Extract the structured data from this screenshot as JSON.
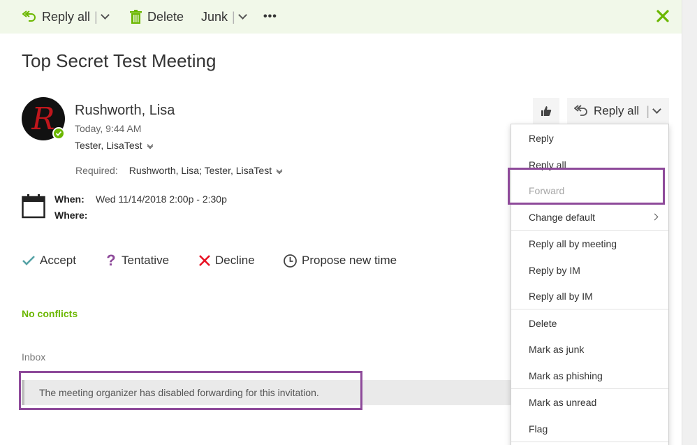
{
  "toolbar": {
    "reply_all_label": "Reply all",
    "delete_label": "Delete",
    "junk_label": "Junk",
    "more_label": "•••"
  },
  "message": {
    "subject": "Top Secret Test Meeting",
    "sender_name": "Rushworth, Lisa",
    "avatar_letter": "R",
    "sent_time": "Today, 9:44 AM",
    "to": "Tester, LisaTest",
    "required_label": "Required:",
    "required_value": "Rushworth, Lisa; Tester, LisaTest",
    "when_label": "When:",
    "when_value": "Wed 11/14/2018 2:00p - 2:30p",
    "where_label": "Where:",
    "no_conflicts": "No conflicts",
    "folder": "Inbox",
    "info_notice": "The meeting organizer has disabled forwarding for this invitation."
  },
  "rsvp": {
    "accept": "Accept",
    "tentative": "Tentative",
    "decline": "Decline",
    "propose": "Propose new time"
  },
  "header_actions": {
    "reply_all_label": "Reply all"
  },
  "menu": {
    "items": [
      {
        "label": "Reply"
      },
      {
        "label": "Reply all"
      },
      {
        "label": "Forward"
      },
      {
        "label": "Change default"
      },
      {
        "label": "Reply all by meeting"
      },
      {
        "label": "Reply by IM"
      },
      {
        "label": "Reply all by IM"
      },
      {
        "label": "Delete"
      },
      {
        "label": "Mark as junk"
      },
      {
        "label": "Mark as phishing"
      },
      {
        "label": "Mark as unread"
      },
      {
        "label": "Flag"
      }
    ]
  },
  "colors": {
    "accent_green": "#6bb700",
    "highlight_purple": "#8e4a9a",
    "decline_red": "#e81123",
    "tentative_purple": "#8e4a9a",
    "toolbar_bg": "#f1f8e9"
  },
  "icons": {
    "reply_all": "reply-all-icon",
    "delete": "trash-icon",
    "close": "close-icon",
    "like": "thumbs-up-icon",
    "calendar": "calendar-icon",
    "accept": "checkmark-icon",
    "tentative": "question-icon",
    "decline": "x-icon",
    "propose": "clock-icon"
  }
}
